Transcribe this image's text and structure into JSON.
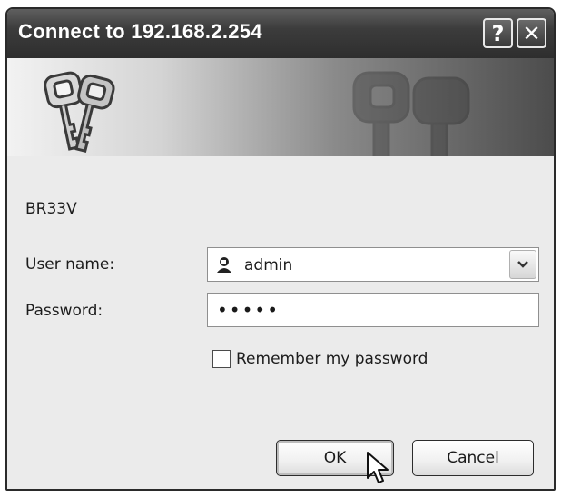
{
  "window": {
    "title": "Connect to 192.168.2.254",
    "help_label": "?",
    "close_label": "✕"
  },
  "banner": {
    "icon": "keys-icon"
  },
  "dialog": {
    "realm": "BR33V",
    "username_label": "User name:",
    "username_value": "admin",
    "username_icon": "user-icon",
    "password_label": "Password:",
    "password_value": "•••••",
    "remember_label": "Remember my password",
    "remember_checked": false
  },
  "buttons": {
    "ok": "OK",
    "cancel": "Cancel"
  },
  "colors": {
    "titlebar": "#3c3c3c",
    "dialog_bg": "#ebebeb",
    "button_border": "#2c2c2c"
  }
}
